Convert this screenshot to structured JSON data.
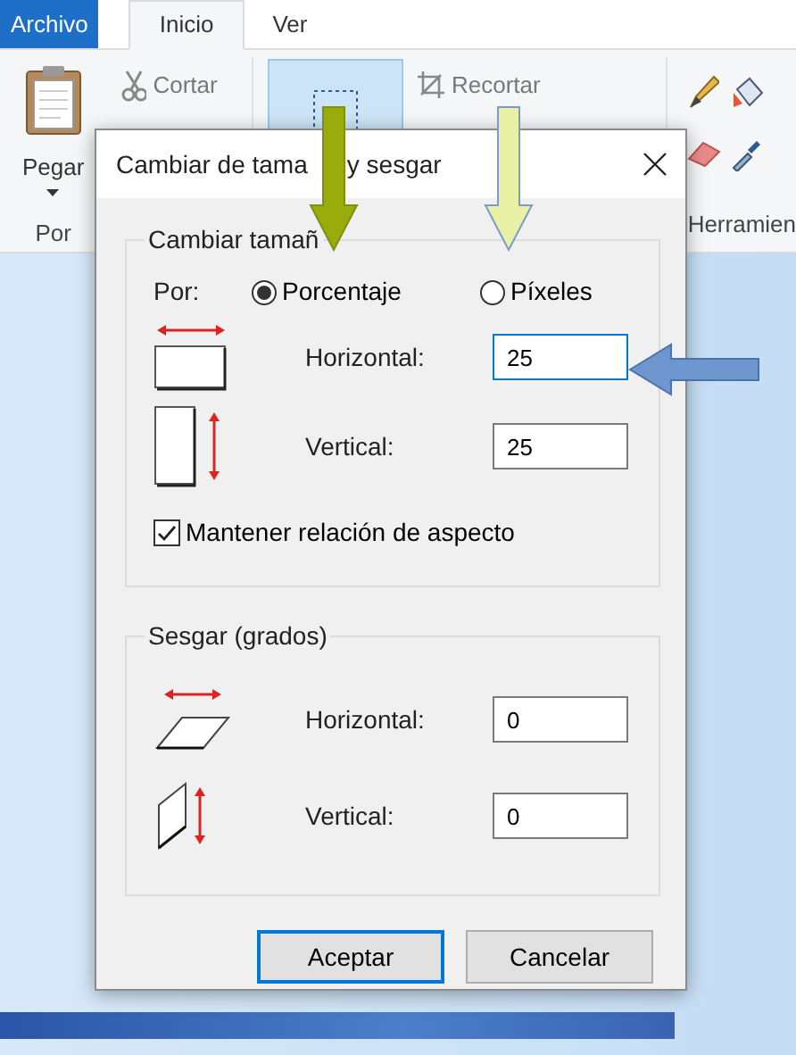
{
  "ribbon": {
    "tabs": [
      {
        "label": "Archivo",
        "kind": "file",
        "selected": false
      },
      {
        "label": "Inicio",
        "kind": "tab",
        "selected": true
      },
      {
        "label": "Ver",
        "kind": "tab",
        "selected": false
      }
    ],
    "paste_label": "Pegar",
    "clipboard_group_label": "Por",
    "cut_label": "Cortar",
    "select_selected": true,
    "crop_label": "Recortar",
    "tools_group_label": "Herramien"
  },
  "dialog": {
    "title_parts": [
      "Cambiar de tama",
      "y sesgar"
    ],
    "resize": {
      "legend": "Cambiar tamañ",
      "by_label": "Por:",
      "radios": [
        {
          "label": "Porcentaje",
          "selected": true
        },
        {
          "label": "Píxeles",
          "selected": false
        }
      ],
      "fields": [
        {
          "kind": "horizontal",
          "label": "Horizontal:",
          "value": "25",
          "focused": true
        },
        {
          "kind": "vertical",
          "label": "Vertical:",
          "value": "25",
          "focused": false
        }
      ],
      "keep_aspect": {
        "label": "Mantener relación de aspecto",
        "checked": true
      }
    },
    "skew": {
      "legend": "Sesgar (grados)",
      "fields": [
        {
          "kind": "skew-horizontal",
          "label": "Horizontal:",
          "value": "0",
          "focused": false
        },
        {
          "kind": "skew-vertical",
          "label": "Vertical:",
          "value": "0",
          "focused": false
        }
      ]
    },
    "buttons": [
      {
        "label": "Aceptar",
        "default": true
      },
      {
        "label": "Cancelar",
        "default": false
      }
    ]
  }
}
